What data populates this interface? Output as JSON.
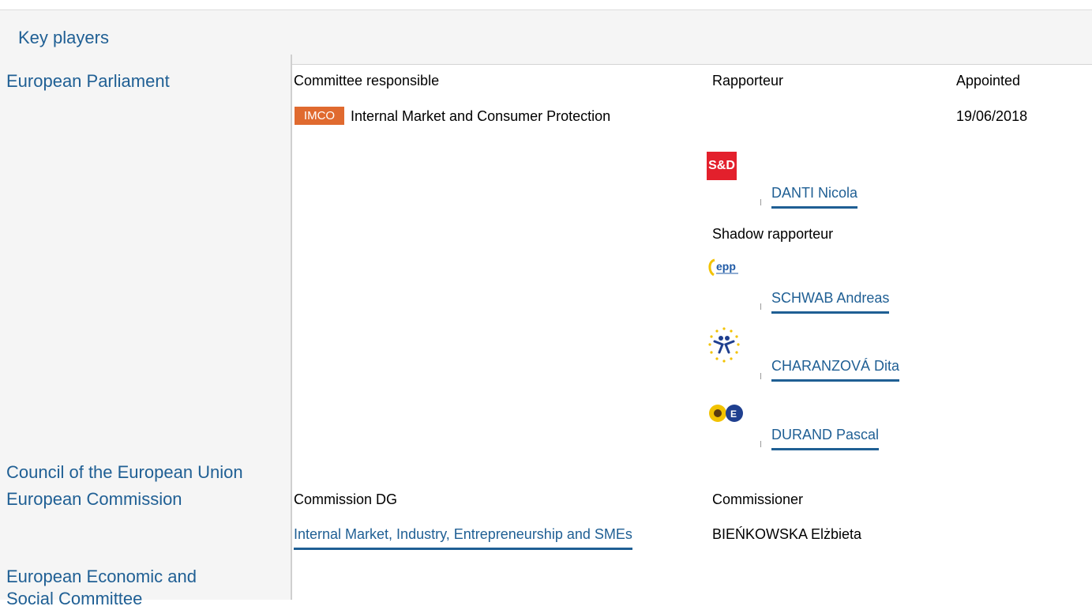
{
  "panel": {
    "title": "Key players"
  },
  "institutions": [
    {
      "label": "European Parliament"
    },
    {
      "label": "Council of the European Union"
    },
    {
      "label": "European Commission"
    },
    {
      "label": "European Economic and Social Committee",
      "line1": "European Economic and",
      "line2": "Social Committee"
    }
  ],
  "parliament": {
    "headers": {
      "committee": "Committee responsible",
      "rapporteur": "Rapporteur",
      "appointed": "Appointed"
    },
    "committee": {
      "badge": "IMCO",
      "name": "Internal Market and Consumer Protection",
      "appointed": "19/06/2018"
    },
    "rapporteur": {
      "group_logo": "S&D",
      "name": "DANTI Nicola"
    },
    "shadow_label": "Shadow rapporteur",
    "shadows": [
      {
        "group_icon": "epp-logo",
        "name": "SCHWAB Andreas"
      },
      {
        "group_icon": "alde-logo",
        "name": "CHARANZOVÁ Dita"
      },
      {
        "group_icon": "greens-efa-logo",
        "name": "DURAND Pascal"
      }
    ]
  },
  "commission": {
    "headers": {
      "dg": "Commission DG",
      "commissioner": "Commissioner"
    },
    "dg": "Internal Market, Industry, Entrepreneurship and SMEs",
    "commissioner": "BIEŃKOWSKA Elżbieta"
  },
  "colors": {
    "link": "#1f5f94",
    "badge": "#e06a2f",
    "sd_red": "#e3202c"
  }
}
